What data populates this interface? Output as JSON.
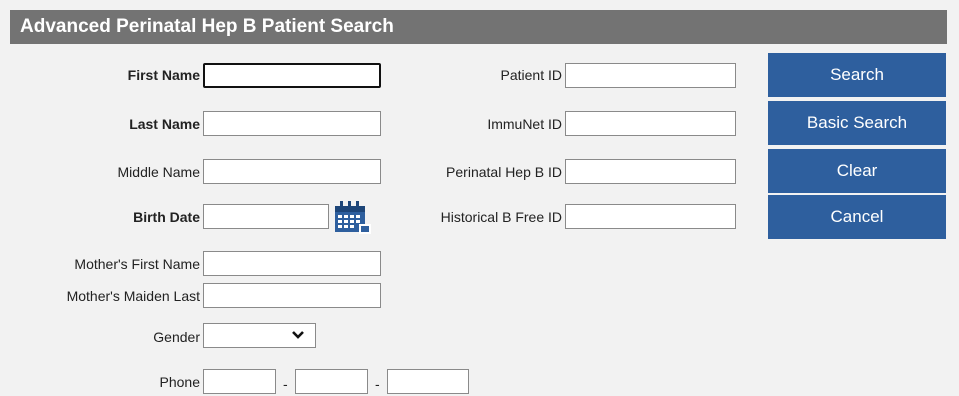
{
  "window": {
    "title": "Advanced Perinatal Hep B Patient Search"
  },
  "fields_left": {
    "first_name": {
      "label": "First Name",
      "value": ""
    },
    "last_name": {
      "label": "Last Name",
      "value": ""
    },
    "middle_name": {
      "label": "Middle Name",
      "value": ""
    },
    "birth_date": {
      "label": "Birth Date",
      "value": ""
    },
    "mothers_first_name": {
      "label": "Mother's First Name",
      "value": ""
    },
    "mothers_maiden_last": {
      "label": "Mother's Maiden Last",
      "value": ""
    },
    "gender": {
      "label": "Gender",
      "selected": ""
    },
    "phone": {
      "label": "Phone",
      "separator": "-",
      "area": "",
      "prefix": "",
      "line": ""
    }
  },
  "fields_right": {
    "patient_id": {
      "label": "Patient ID",
      "value": ""
    },
    "immunet_id": {
      "label": "ImmuNet ID",
      "value": ""
    },
    "perinatal_hep_b_id": {
      "label": "Perinatal Hep B ID",
      "value": ""
    },
    "historical_b_free_id": {
      "label": "Historical B Free ID",
      "value": ""
    }
  },
  "buttons": {
    "search": "Search",
    "basic_search": "Basic Search",
    "clear": "Clear",
    "cancel": "Cancel"
  },
  "icons": {
    "calendar": "calendar-icon",
    "dropdown": "chevron-down-icon"
  },
  "colors": {
    "title_bar": "#737373",
    "button": "#2e5f9e",
    "background": "#f2f2f2"
  }
}
